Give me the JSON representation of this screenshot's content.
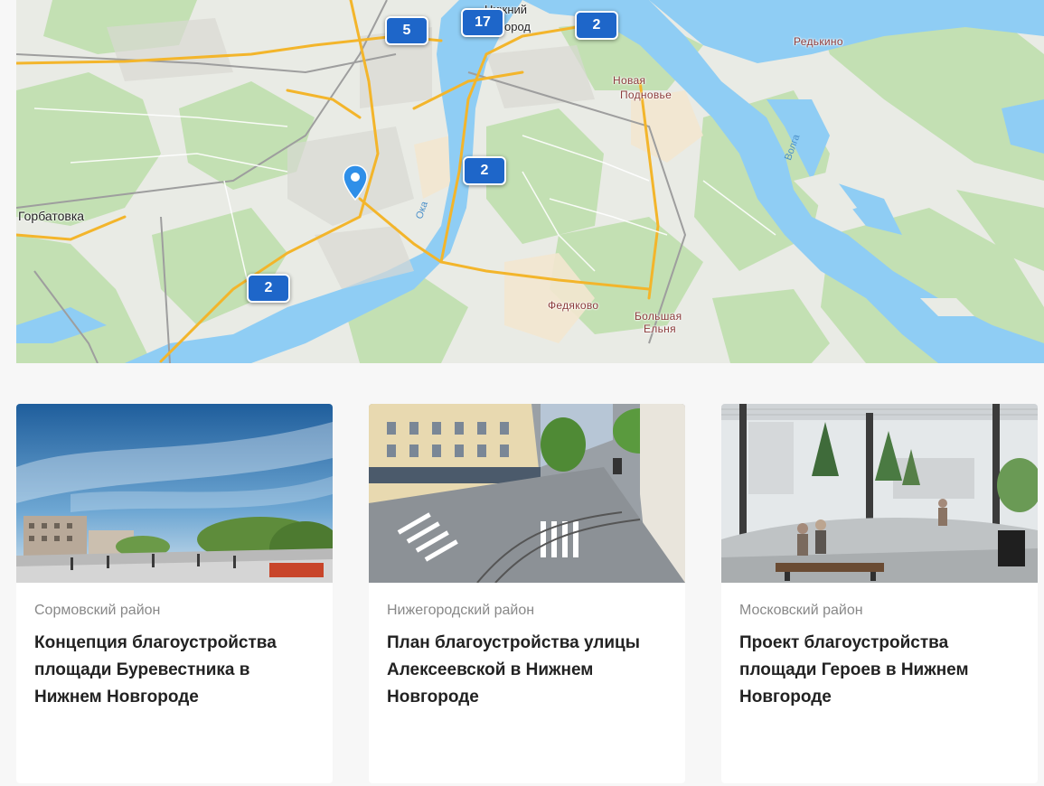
{
  "map": {
    "labels": {
      "gorbatovka": "Горбатовка",
      "redkino": "Редькино",
      "novoe_podnovye_1": "Новая",
      "novoe_podnovye_2": "Подновье",
      "fedyakovo": "Федяково",
      "bolshaya_elnya_1": "Большая",
      "bolshaya_elnya_2": "Ельня",
      "nizhniy_1": "Нижний",
      "nizhniy_2": "Новгород",
      "oka": "Ока",
      "volga": "Волга"
    },
    "clusters": [
      {
        "label": "5"
      },
      {
        "label": "17"
      },
      {
        "label": "2"
      },
      {
        "label": "2"
      },
      {
        "label": "2"
      }
    ],
    "colors": {
      "water": "#8fcdf4",
      "land": "#e9ebe5",
      "green": "#c3e0b3",
      "road": "#f3b52b",
      "cluster": "#1e66c9",
      "pin": "#2f8fe8"
    }
  },
  "cards": [
    {
      "district": "Сормовский район",
      "title": "Концепция благоустройства площади Буревестника в Нижнем Новгороде"
    },
    {
      "district": "Нижегородский район",
      "title": "План благоустройства улицы Алексеевской в Нижнем Новгороде"
    },
    {
      "district": "Московский район",
      "title": "Проект благоустройства площади Героев в Нижнем Новгороде"
    }
  ]
}
